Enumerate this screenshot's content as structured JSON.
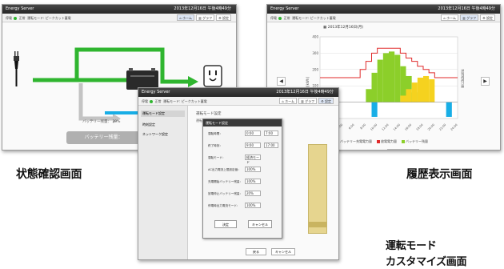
{
  "windows": {
    "status": {
      "app_title": "Energy Server",
      "datetime": "2013年12月16日 午後4時49分",
      "status_bar": {
        "operation": "停電",
        "state": "正常",
        "mode_label": "運転モード:",
        "mode_value": "ピークカット蓄電"
      },
      "nav": {
        "home": "ホーム",
        "history": "グラフ",
        "settings": "設定"
      },
      "battery_label": "バッテリー残量：",
      "battery_percent": "39%",
      "battery_button": "バッテリー残量：",
      "load_label": "分電盤負荷"
    },
    "history": {
      "app_title": "Energy Server",
      "datetime": "2013年12月16日 午後4時49分",
      "status_bar": {
        "operation": "停電",
        "state": "正常",
        "mode_label": "運転モード:",
        "mode_value": "ピークカット蓄電"
      },
      "nav": {
        "home": "ホーム",
        "history": "グラフ",
        "settings": "設定"
      },
      "date_label": "2013年12月16日(月)",
      "ylabel": "電力量[kWh]",
      "ylabel_right": "充放電電力量",
      "y_ticks": [
        "400",
        "300",
        "200",
        "100",
        "0"
      ],
      "x_ticks": [
        "0:00",
        "2:00",
        "4:00",
        "6:00",
        "8:00",
        "10:00",
        "12:00",
        "14:00",
        "16:00",
        "18:00",
        "20:00",
        "22:00",
        "24:00"
      ],
      "legend": [
        "バッテリー充電電力量",
        "放電電力量",
        "バッテリー残量"
      ],
      "bottom_button": "戻る"
    },
    "custom": {
      "app_title": "Energy Server",
      "datetime": "2013年12月16日 午後4時49分",
      "status_bar": {
        "operation": "停電",
        "state": "正常",
        "mode_label": "運転モード:",
        "mode_value": "ピークカット蓄電"
      },
      "nav": {
        "home": "ホーム",
        "history": "グラフ",
        "settings": "設定"
      },
      "sidebar": [
        "運転モード設定",
        "時刻設定",
        "ネットワーク設定"
      ],
      "panel_title": "運転モード設定",
      "panel_sub": "運転モード",
      "bottom_buttons": [
        "戻る",
        "キャンセル"
      ],
      "dialog": {
        "title": "運転モード設定",
        "fields": [
          {
            "label": "運転時間：",
            "a": "0:00",
            "b": "7:00"
          },
          {
            "label": "終了時刻：",
            "a": "9:00",
            "b": "17:00"
          },
          {
            "label": "運転モード：",
            "a": "経済モード",
            "b": ""
          },
          {
            "label": "AC出力電流上限設定値：",
            "a": "100%",
            "b": ""
          },
          {
            "label": "充電開始バッテリー残量：",
            "a": "100%",
            "b": ""
          },
          {
            "label": "放電停止バッテリー残量：",
            "a": "20%",
            "b": ""
          },
          {
            "label": "停電時出力電流モード：",
            "a": "100%",
            "b": ""
          }
        ],
        "ok": "決定",
        "cancel": "キャンセル"
      }
    }
  },
  "captions": {
    "status": "状態確認画面",
    "history": "履歴表示画面",
    "custom_line1": "運転モード",
    "custom_line2": "カスタマイズ画面"
  },
  "colors": {
    "flow_green": "#2fb52f",
    "flow_gray": "#bdbdbd",
    "bar_green": "#8ccf2a",
    "bar_yellow": "#f5d21f",
    "bar_cyan": "#18aee6",
    "line_red": "#e02a2a",
    "panel_khaki": "#e6d58f"
  },
  "chart_data": {
    "type": "bar",
    "title": "2013年12月16日(月)",
    "categories": [
      "0",
      "1",
      "2",
      "3",
      "4",
      "5",
      "6",
      "7",
      "8",
      "9",
      "10",
      "11",
      "12",
      "13",
      "14",
      "15",
      "16",
      "17",
      "18",
      "19",
      "20",
      "21",
      "22",
      "23"
    ],
    "series": [
      {
        "name": "バッテリー充電電力量",
        "values": [
          0,
          0,
          0,
          0,
          0,
          0,
          0,
          0,
          80,
          180,
          260,
          300,
          310,
          290,
          220,
          160,
          60,
          0,
          0,
          0,
          0,
          0,
          0,
          0
        ]
      },
      {
        "name": "放電電力量",
        "values": [
          0,
          0,
          0,
          0,
          0,
          0,
          0,
          0,
          0,
          0,
          0,
          0,
          0,
          0,
          40,
          80,
          120,
          150,
          160,
          140,
          0,
          0,
          0,
          0
        ]
      },
      {
        "name": "バッテリー残量",
        "values": [
          150,
          150,
          150,
          150,
          150,
          150,
          150,
          200,
          250,
          300,
          330,
          330,
          330,
          330,
          300,
          270,
          250,
          220,
          200,
          180,
          150,
          150,
          150,
          150
        ]
      }
    ],
    "ylim": [
      -100,
      400
    ]
  }
}
